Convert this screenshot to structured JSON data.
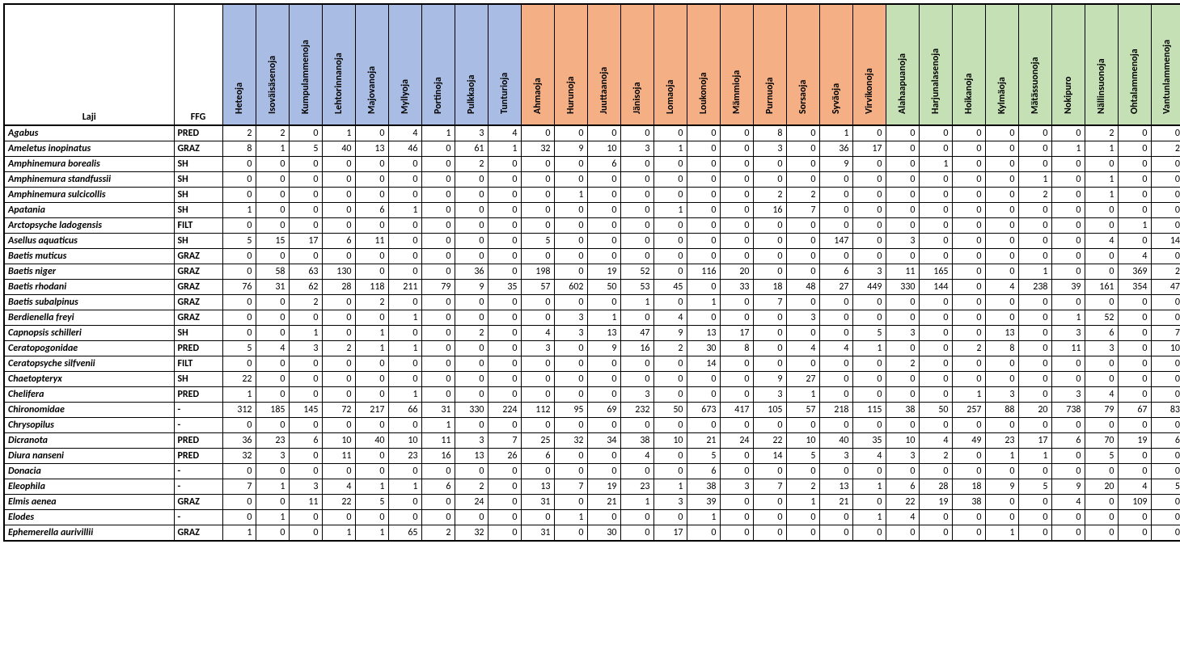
{
  "chart_data": {
    "type": "table",
    "title": "",
    "row_header": "Laji",
    "col_header_ffg": "FFG",
    "stream_groups": [
      "blue",
      "blue",
      "blue",
      "blue",
      "blue",
      "blue",
      "blue",
      "blue",
      "blue",
      "orange",
      "orange",
      "orange",
      "orange",
      "orange",
      "orange",
      "orange",
      "orange",
      "orange",
      "orange",
      "orange",
      "green",
      "green",
      "green",
      "green",
      "green",
      "green",
      "green",
      "green",
      "green"
    ],
    "streams": [
      "Heteoja",
      "Isoväisäsenoja",
      "Kumpulammenoja",
      "Lehtorinnanoja",
      "Majovanoja",
      "Myllyoja",
      "Portinoja",
      "Pulkkaoja",
      "Tunturioja",
      "Ahmaoja",
      "Hurunoja",
      "Juuttaanoja",
      "Jänisoja",
      "Lomaoja",
      "Loukonoja",
      "Mämmioja",
      "Purnuoja",
      "Sorsaoja",
      "Syväoja",
      "Virvikonoja",
      "Alahaapuanoja",
      "Harjunalasenoja",
      "Hoikanoja",
      "Kylmäoja",
      "Mätässuonoja",
      "Nokipuro",
      "Nällinsuonoja",
      "Ohtalammenoja",
      "Vantunlammenoja"
    ],
    "rows": [
      {
        "laji": "Agabus",
        "ffg": "PRED",
        "v": [
          2,
          2,
          0,
          1,
          0,
          4,
          1,
          3,
          4,
          0,
          0,
          0,
          0,
          0,
          0,
          0,
          8,
          0,
          1,
          0,
          0,
          0,
          0,
          0,
          0,
          0,
          2,
          0,
          0
        ]
      },
      {
        "laji": "Ameletus inopinatus",
        "ffg": "GRAZ",
        "v": [
          8,
          1,
          5,
          40,
          13,
          46,
          0,
          61,
          1,
          32,
          9,
          10,
          3,
          1,
          0,
          0,
          3,
          0,
          36,
          17,
          0,
          0,
          0,
          0,
          0,
          1,
          1,
          0,
          2
        ]
      },
      {
        "laji": "Amphinemura borealis",
        "ffg": "SH",
        "v": [
          0,
          0,
          0,
          0,
          0,
          0,
          0,
          2,
          0,
          0,
          0,
          6,
          0,
          0,
          0,
          0,
          0,
          0,
          9,
          0,
          0,
          1,
          0,
          0,
          0,
          0,
          0,
          0,
          0
        ]
      },
      {
        "laji": "Amphinemura standfussii",
        "ffg": "SH",
        "v": [
          0,
          0,
          0,
          0,
          0,
          0,
          0,
          0,
          0,
          0,
          0,
          0,
          0,
          0,
          0,
          0,
          0,
          0,
          0,
          0,
          0,
          0,
          0,
          0,
          1,
          0,
          1,
          0,
          0
        ]
      },
      {
        "laji": "Amphinemura sulcicollis",
        "ffg": "SH",
        "v": [
          0,
          0,
          0,
          0,
          0,
          0,
          0,
          0,
          0,
          0,
          1,
          0,
          0,
          0,
          0,
          0,
          2,
          2,
          0,
          0,
          0,
          0,
          0,
          0,
          2,
          0,
          1,
          0,
          0
        ]
      },
      {
        "laji": "Apatania",
        "ffg": "SH",
        "v": [
          1,
          0,
          0,
          0,
          6,
          1,
          0,
          0,
          0,
          0,
          0,
          0,
          0,
          1,
          0,
          0,
          16,
          7,
          0,
          0,
          0,
          0,
          0,
          0,
          0,
          0,
          0,
          0,
          0
        ]
      },
      {
        "laji": "Arctopsyche ladogensis",
        "ffg": "FILT",
        "v": [
          0,
          0,
          0,
          0,
          0,
          0,
          0,
          0,
          0,
          0,
          0,
          0,
          0,
          0,
          0,
          0,
          0,
          0,
          0,
          0,
          0,
          0,
          0,
          0,
          0,
          0,
          0,
          1,
          0
        ]
      },
      {
        "laji": "Asellus aquaticus",
        "ffg": "SH",
        "v": [
          5,
          15,
          17,
          6,
          11,
          0,
          0,
          0,
          0,
          5,
          0,
          0,
          0,
          0,
          0,
          0,
          0,
          0,
          147,
          0,
          3,
          0,
          0,
          0,
          0,
          0,
          4,
          0,
          14
        ]
      },
      {
        "laji": "Baetis muticus",
        "ffg": "GRAZ",
        "v": [
          0,
          0,
          0,
          0,
          0,
          0,
          0,
          0,
          0,
          0,
          0,
          0,
          0,
          0,
          0,
          0,
          0,
          0,
          0,
          0,
          0,
          0,
          0,
          0,
          0,
          0,
          0,
          4,
          0
        ]
      },
      {
        "laji": "Baetis niger",
        "ffg": "GRAZ",
        "v": [
          0,
          58,
          63,
          130,
          0,
          0,
          0,
          36,
          0,
          198,
          0,
          19,
          52,
          0,
          116,
          20,
          0,
          0,
          6,
          3,
          11,
          165,
          0,
          0,
          1,
          0,
          0,
          369,
          2
        ]
      },
      {
        "laji": "Baetis rhodani",
        "ffg": "GRAZ",
        "v": [
          76,
          31,
          62,
          28,
          118,
          211,
          79,
          9,
          35,
          57,
          602,
          50,
          53,
          45,
          0,
          33,
          18,
          48,
          27,
          449,
          330,
          144,
          0,
          4,
          238,
          39,
          161,
          354,
          47
        ]
      },
      {
        "laji": "Baetis subalpinus",
        "ffg": "GRAZ",
        "v": [
          0,
          0,
          2,
          0,
          2,
          0,
          0,
          0,
          0,
          0,
          0,
          0,
          1,
          0,
          1,
          0,
          7,
          0,
          0,
          0,
          0,
          0,
          0,
          0,
          0,
          0,
          0,
          0,
          0
        ]
      },
      {
        "laji": "Berdienella freyi",
        "ffg": "GRAZ",
        "v": [
          0,
          0,
          0,
          0,
          0,
          1,
          0,
          0,
          0,
          0,
          3,
          1,
          0,
          4,
          0,
          0,
          0,
          3,
          0,
          0,
          0,
          0,
          0,
          0,
          0,
          1,
          52,
          0,
          0
        ]
      },
      {
        "laji": "Capnopsis schilleri",
        "ffg": "SH",
        "v": [
          0,
          0,
          1,
          0,
          1,
          0,
          0,
          2,
          0,
          4,
          3,
          13,
          47,
          9,
          13,
          17,
          0,
          0,
          0,
          5,
          3,
          0,
          0,
          13,
          0,
          3,
          6,
          0,
          7
        ]
      },
      {
        "laji": "Ceratopogonidae",
        "ffg": "PRED",
        "v": [
          5,
          4,
          3,
          2,
          1,
          1,
          0,
          0,
          0,
          3,
          0,
          9,
          16,
          2,
          30,
          8,
          0,
          4,
          4,
          1,
          0,
          0,
          2,
          8,
          0,
          11,
          3,
          0,
          10
        ]
      },
      {
        "laji": "Ceratopsyche silfvenii",
        "ffg": "FILT",
        "v": [
          0,
          0,
          0,
          0,
          0,
          0,
          0,
          0,
          0,
          0,
          0,
          0,
          0,
          0,
          14,
          0,
          0,
          0,
          0,
          0,
          2,
          0,
          0,
          0,
          0,
          0,
          0,
          0,
          0
        ]
      },
      {
        "laji": "Chaetopteryx",
        "ffg": "SH",
        "v": [
          22,
          0,
          0,
          0,
          0,
          0,
          0,
          0,
          0,
          0,
          0,
          0,
          0,
          0,
          0,
          0,
          9,
          27,
          0,
          0,
          0,
          0,
          0,
          0,
          0,
          0,
          0,
          0,
          0
        ]
      },
      {
        "laji": "Chelifera",
        "ffg": "PRED",
        "v": [
          1,
          0,
          0,
          0,
          0,
          1,
          0,
          0,
          0,
          0,
          0,
          0,
          3,
          0,
          0,
          0,
          3,
          1,
          0,
          0,
          0,
          0,
          1,
          3,
          0,
          3,
          4,
          0,
          0
        ]
      },
      {
        "laji": "Chironomidae",
        "ffg": "-",
        "v": [
          312,
          185,
          145,
          72,
          217,
          66,
          31,
          330,
          224,
          112,
          95,
          69,
          232,
          50,
          673,
          417,
          105,
          57,
          218,
          115,
          38,
          50,
          257,
          88,
          20,
          738,
          79,
          67,
          83
        ]
      },
      {
        "laji": "Chrysopilus",
        "ffg": "-",
        "v": [
          0,
          0,
          0,
          0,
          0,
          0,
          1,
          0,
          0,
          0,
          0,
          0,
          0,
          0,
          0,
          0,
          0,
          0,
          0,
          0,
          0,
          0,
          0,
          0,
          0,
          0,
          0,
          0,
          0
        ]
      },
      {
        "laji": "Dicranota",
        "ffg": "PRED",
        "v": [
          36,
          23,
          6,
          10,
          40,
          10,
          11,
          3,
          7,
          25,
          32,
          34,
          38,
          10,
          21,
          24,
          22,
          10,
          40,
          35,
          10,
          4,
          49,
          23,
          17,
          6,
          70,
          19,
          6
        ]
      },
      {
        "laji": "Diura nanseni",
        "ffg": "PRED",
        "v": [
          32,
          3,
          0,
          11,
          0,
          23,
          16,
          13,
          26,
          6,
          0,
          0,
          4,
          0,
          5,
          0,
          14,
          5,
          3,
          4,
          3,
          2,
          0,
          1,
          1,
          0,
          5,
          0,
          0
        ]
      },
      {
        "laji": "Donacia",
        "ffg": "-",
        "v": [
          0,
          0,
          0,
          0,
          0,
          0,
          0,
          0,
          0,
          0,
          0,
          0,
          0,
          0,
          6,
          0,
          0,
          0,
          0,
          0,
          0,
          0,
          0,
          0,
          0,
          0,
          0,
          0,
          0
        ]
      },
      {
        "laji": "Eleophila",
        "ffg": "-",
        "v": [
          7,
          1,
          3,
          4,
          1,
          1,
          6,
          2,
          0,
          13,
          7,
          19,
          23,
          1,
          38,
          3,
          7,
          2,
          13,
          1,
          6,
          28,
          18,
          9,
          5,
          9,
          20,
          4,
          5
        ]
      },
      {
        "laji": "Elmis aenea",
        "ffg": "GRAZ",
        "v": [
          0,
          0,
          11,
          22,
          5,
          0,
          0,
          24,
          0,
          31,
          0,
          21,
          1,
          3,
          39,
          0,
          0,
          1,
          21,
          0,
          22,
          19,
          38,
          0,
          0,
          4,
          0,
          109,
          0
        ]
      },
      {
        "laji": "Elodes",
        "ffg": "-",
        "v": [
          0,
          1,
          0,
          0,
          0,
          0,
          0,
          0,
          0,
          0,
          1,
          0,
          0,
          0,
          1,
          0,
          0,
          0,
          0,
          1,
          4,
          0,
          0,
          0,
          0,
          0,
          0,
          0,
          0
        ]
      },
      {
        "laji": "Ephemerella aurivillii",
        "ffg": "GRAZ",
        "v": [
          1,
          0,
          0,
          1,
          1,
          65,
          2,
          32,
          0,
          31,
          0,
          30,
          0,
          17,
          0,
          0,
          0,
          0,
          0,
          0,
          0,
          0,
          0,
          1,
          0,
          0,
          0,
          0,
          0
        ]
      }
    ]
  }
}
